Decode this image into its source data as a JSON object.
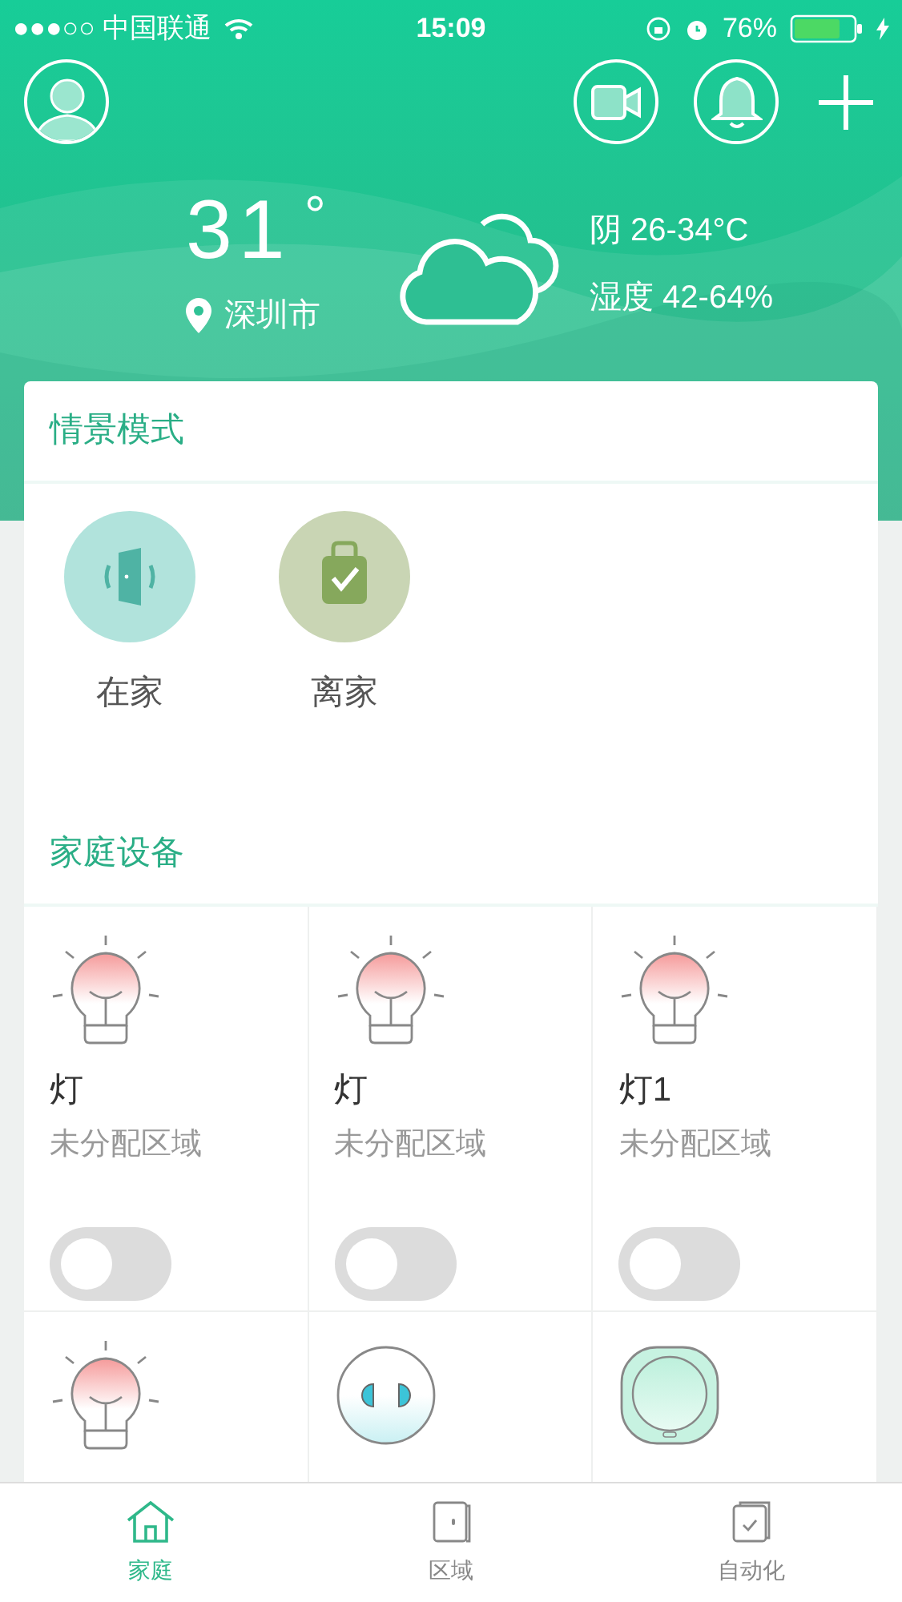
{
  "status_bar": {
    "carrier": "●●●○○ 中国联通",
    "time": "15:09",
    "battery": "76%"
  },
  "weather": {
    "temperature": "31",
    "degree": "°",
    "city": "深圳市",
    "condition": "阴 26-34°C",
    "humidity": "湿度 42-64%"
  },
  "scenes": {
    "title": "情景模式",
    "items": [
      {
        "kind": "home",
        "label": "在家"
      },
      {
        "kind": "away",
        "label": "离家"
      }
    ]
  },
  "devices": {
    "title": "家庭设备",
    "items": [
      {
        "kind": "bulb",
        "name": "灯",
        "area": "未分配区域",
        "on": false
      },
      {
        "kind": "bulb",
        "name": "灯",
        "area": "未分配区域",
        "on": false
      },
      {
        "kind": "bulb",
        "name": "灯1",
        "area": "未分配区域",
        "on": false
      },
      {
        "kind": "bulb"
      },
      {
        "kind": "socket"
      },
      {
        "kind": "sensor"
      }
    ]
  },
  "tabs": [
    {
      "kind": "home",
      "label": "家庭",
      "selected": true
    },
    {
      "kind": "area",
      "label": "区域",
      "selected": false
    },
    {
      "kind": "automation",
      "label": "自动化",
      "selected": false
    }
  ]
}
